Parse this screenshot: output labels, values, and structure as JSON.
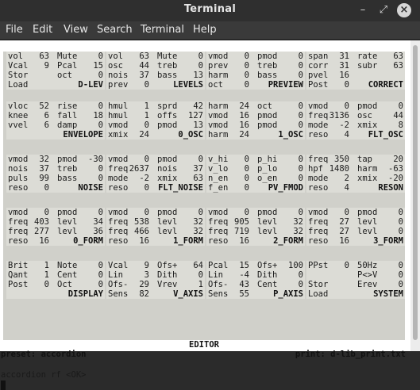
{
  "window": {
    "title": "Terminal"
  },
  "menu": [
    "File",
    "Edit",
    "View",
    "Search",
    "Terminal",
    "Help"
  ],
  "rows": [
    [
      {
        "name": "D-LEV",
        "lines": [
          [
            "vol",
            "63",
            "Mute",
            "0"
          ],
          [
            "Vcal",
            "9",
            "Pcal",
            "15"
          ],
          [
            "Stor",
            "",
            "oct",
            "0"
          ],
          [
            "Load",
            "",
            "",
            ""
          ]
        ]
      },
      {
        "name": "LEVELS",
        "lines": [
          [
            "vol",
            "63",
            "Mute",
            "0"
          ],
          [
            "osc",
            "44",
            "treb",
            "0"
          ],
          [
            "nois",
            "37",
            "bass",
            "13"
          ],
          [
            "prev",
            "0",
            "",
            ""
          ]
        ]
      },
      {
        "name": "PREVIEW",
        "lines": [
          [
            "vmod",
            "0",
            "pmod",
            "0"
          ],
          [
            "prev",
            "0",
            "treb",
            "0"
          ],
          [
            "harm",
            "0",
            "bass",
            "0"
          ],
          [
            "oct",
            "0",
            "",
            ""
          ]
        ]
      },
      {
        "name": "CORRECT",
        "lines": [
          [
            "span",
            "31",
            "rate",
            "63"
          ],
          [
            "corr",
            "31",
            "subr",
            "63"
          ],
          [
            "pvel",
            "16",
            "",
            ""
          ],
          [
            "Post",
            "0",
            "",
            ""
          ]
        ]
      }
    ],
    [
      {
        "name": "ENVELOPE",
        "lines": [
          [
            "vloc",
            "52",
            "rise",
            "0"
          ],
          [
            "knee",
            "6",
            "fall",
            "18"
          ],
          [
            "vvel",
            "6",
            "damp",
            "0"
          ],
          [
            "",
            "",
            "",
            ""
          ]
        ]
      },
      {
        "name": "0_OSC",
        "lines": [
          [
            "hmul",
            "1",
            "sprd",
            "42"
          ],
          [
            "hmul",
            "1",
            "offs",
            "127"
          ],
          [
            "vmod",
            "0",
            "pmod",
            "13"
          ],
          [
            "xmix",
            "24",
            "",
            ""
          ]
        ]
      },
      {
        "name": "1_OSC",
        "lines": [
          [
            "harm",
            "24",
            "oct",
            "0"
          ],
          [
            "vmod",
            "16",
            "pmod",
            "0"
          ],
          [
            "vmod",
            "16",
            "pmod",
            "0"
          ],
          [
            "harm",
            "24",
            "",
            ""
          ]
        ]
      },
      {
        "name": "FLT_OSC",
        "lines": [
          [
            "vmod",
            "0",
            "pmod",
            "0"
          ],
          [
            "freq",
            "3136",
            "osc",
            "44"
          ],
          [
            "mode",
            "-2",
            "xmix",
            "8"
          ],
          [
            "reso",
            "4",
            "",
            ""
          ]
        ]
      }
    ],
    [
      {
        "name": "NOISE",
        "lines": [
          [
            "vmod",
            "32",
            "pmod",
            "-30"
          ],
          [
            "nois",
            "37",
            "treb",
            "0"
          ],
          [
            "puls",
            "99",
            "bass",
            "0"
          ],
          [
            "reso",
            "0",
            "",
            ""
          ]
        ]
      },
      {
        "name": "FLT_NOISE",
        "lines": [
          [
            "vmod",
            "0",
            "pmod",
            "0"
          ],
          [
            "freq",
            "2637",
            "nois",
            "37"
          ],
          [
            "mode",
            "-2",
            "xmix",
            "63"
          ],
          [
            "reso",
            "0",
            "",
            ""
          ]
        ]
      },
      {
        "name": "PV_FMOD",
        "lines": [
          [
            "v_hi",
            "0",
            "p_hi",
            "0"
          ],
          [
            "v_lo",
            "0",
            "p_lo",
            "0"
          ],
          [
            "n_en",
            "0",
            "o_en",
            "0"
          ],
          [
            "f_en",
            "0",
            "",
            ""
          ]
        ]
      },
      {
        "name": "RESON",
        "lines": [
          [
            "freq",
            "350",
            "tap",
            "20"
          ],
          [
            "hpf",
            "1480",
            "harm",
            "-63"
          ],
          [
            "mode",
            "2",
            "xmix",
            "-20"
          ],
          [
            "reso",
            "4",
            "",
            ""
          ]
        ]
      }
    ],
    [
      {
        "name": "0_FORM",
        "lines": [
          [
            "vmod",
            "0",
            "pmod",
            "0"
          ],
          [
            "freq",
            "403",
            "levl",
            "34"
          ],
          [
            "freq",
            "277",
            "levl",
            "36"
          ],
          [
            "reso",
            "16",
            "",
            ""
          ]
        ]
      },
      {
        "name": "1_FORM",
        "lines": [
          [
            "vmod",
            "0",
            "pmod",
            "0"
          ],
          [
            "freq",
            "538",
            "levl",
            "32"
          ],
          [
            "freq",
            "466",
            "levl",
            "32"
          ],
          [
            "reso",
            "16",
            "",
            ""
          ]
        ]
      },
      {
        "name": "2_FORM",
        "lines": [
          [
            "vmod",
            "0",
            "pmod",
            "0"
          ],
          [
            "freq",
            "905",
            "levl",
            "32"
          ],
          [
            "freq",
            "719",
            "levl",
            "32"
          ],
          [
            "reso",
            "16",
            "",
            ""
          ]
        ]
      },
      {
        "name": "3_FORM",
        "lines": [
          [
            "vmod",
            "0",
            "pmod",
            "0"
          ],
          [
            "freq",
            "27",
            "levl",
            "0"
          ],
          [
            "freq",
            "27",
            "levl",
            "0"
          ],
          [
            "reso",
            "16",
            "",
            ""
          ]
        ]
      }
    ],
    [
      {
        "name": "DISPLAY",
        "lines": [
          [
            "Brit",
            "1",
            "Note",
            "0"
          ],
          [
            "Qant",
            "1",
            "Cent",
            "0"
          ],
          [
            "Post",
            "0",
            "Oct",
            "0"
          ],
          [
            "",
            "",
            "",
            ""
          ]
        ]
      },
      {
        "name": "V_AXIS",
        "lines": [
          [
            "Vcal",
            "9",
            "Ofs+",
            "64"
          ],
          [
            "Lin",
            "3",
            "Dith",
            "0"
          ],
          [
            "Ofs-",
            "29",
            "Vrev",
            "1"
          ],
          [
            "Sens",
            "82",
            "",
            ""
          ]
        ]
      },
      {
        "name": "P_AXIS",
        "lines": [
          [
            "Pcal",
            "15",
            "Ofs+",
            "100"
          ],
          [
            "Lin",
            "-4",
            "Dith",
            "0"
          ],
          [
            "Ofs-",
            "43",
            "Cent",
            "0"
          ],
          [
            "Sens",
            "55",
            "",
            ""
          ]
        ]
      },
      {
        "name": "SYSTEM",
        "lines": [
          [
            "PPst",
            "0",
            "50Hz",
            "0"
          ],
          [
            "",
            "",
            "P<>V",
            "0"
          ],
          [
            "Stor",
            "",
            "Erev",
            "0"
          ],
          [
            "Load",
            "",
            "",
            ""
          ]
        ]
      }
    ]
  ],
  "editor_label": "EDITOR",
  "status": {
    "preset": "preset: accordion",
    "print": "print: d-lib_print.txt"
  },
  "command": "accordion rf <OK>"
}
